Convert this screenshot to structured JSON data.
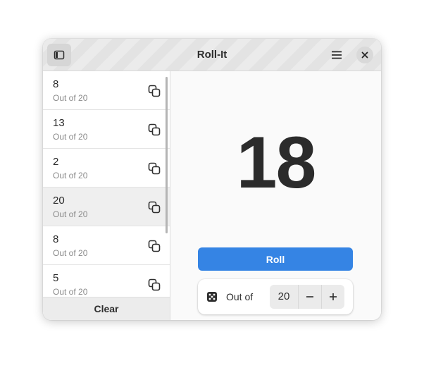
{
  "window": {
    "title": "Roll-It"
  },
  "headerbar": {
    "sidebar_toggle_icon": "sidebar-show-icon",
    "menu_icon": "hamburger-menu-icon",
    "close_icon": "close-icon"
  },
  "history": {
    "items": [
      {
        "value": "8",
        "subtitle": "Out of 20"
      },
      {
        "value": "13",
        "subtitle": "Out of 20"
      },
      {
        "value": "2",
        "subtitle": "Out of 20"
      },
      {
        "value": "20",
        "subtitle": "Out of 20"
      },
      {
        "value": "8",
        "subtitle": "Out of 20"
      },
      {
        "value": "5",
        "subtitle": "Out of 20"
      }
    ],
    "copy_icon": "copy-icon",
    "clear_label": "Clear"
  },
  "main": {
    "result": "18",
    "roll_label": "Roll",
    "out_of_label": "Out of",
    "out_of_value": "20",
    "dice_icon": "dice-icon",
    "accent_color": "#3584e4"
  }
}
